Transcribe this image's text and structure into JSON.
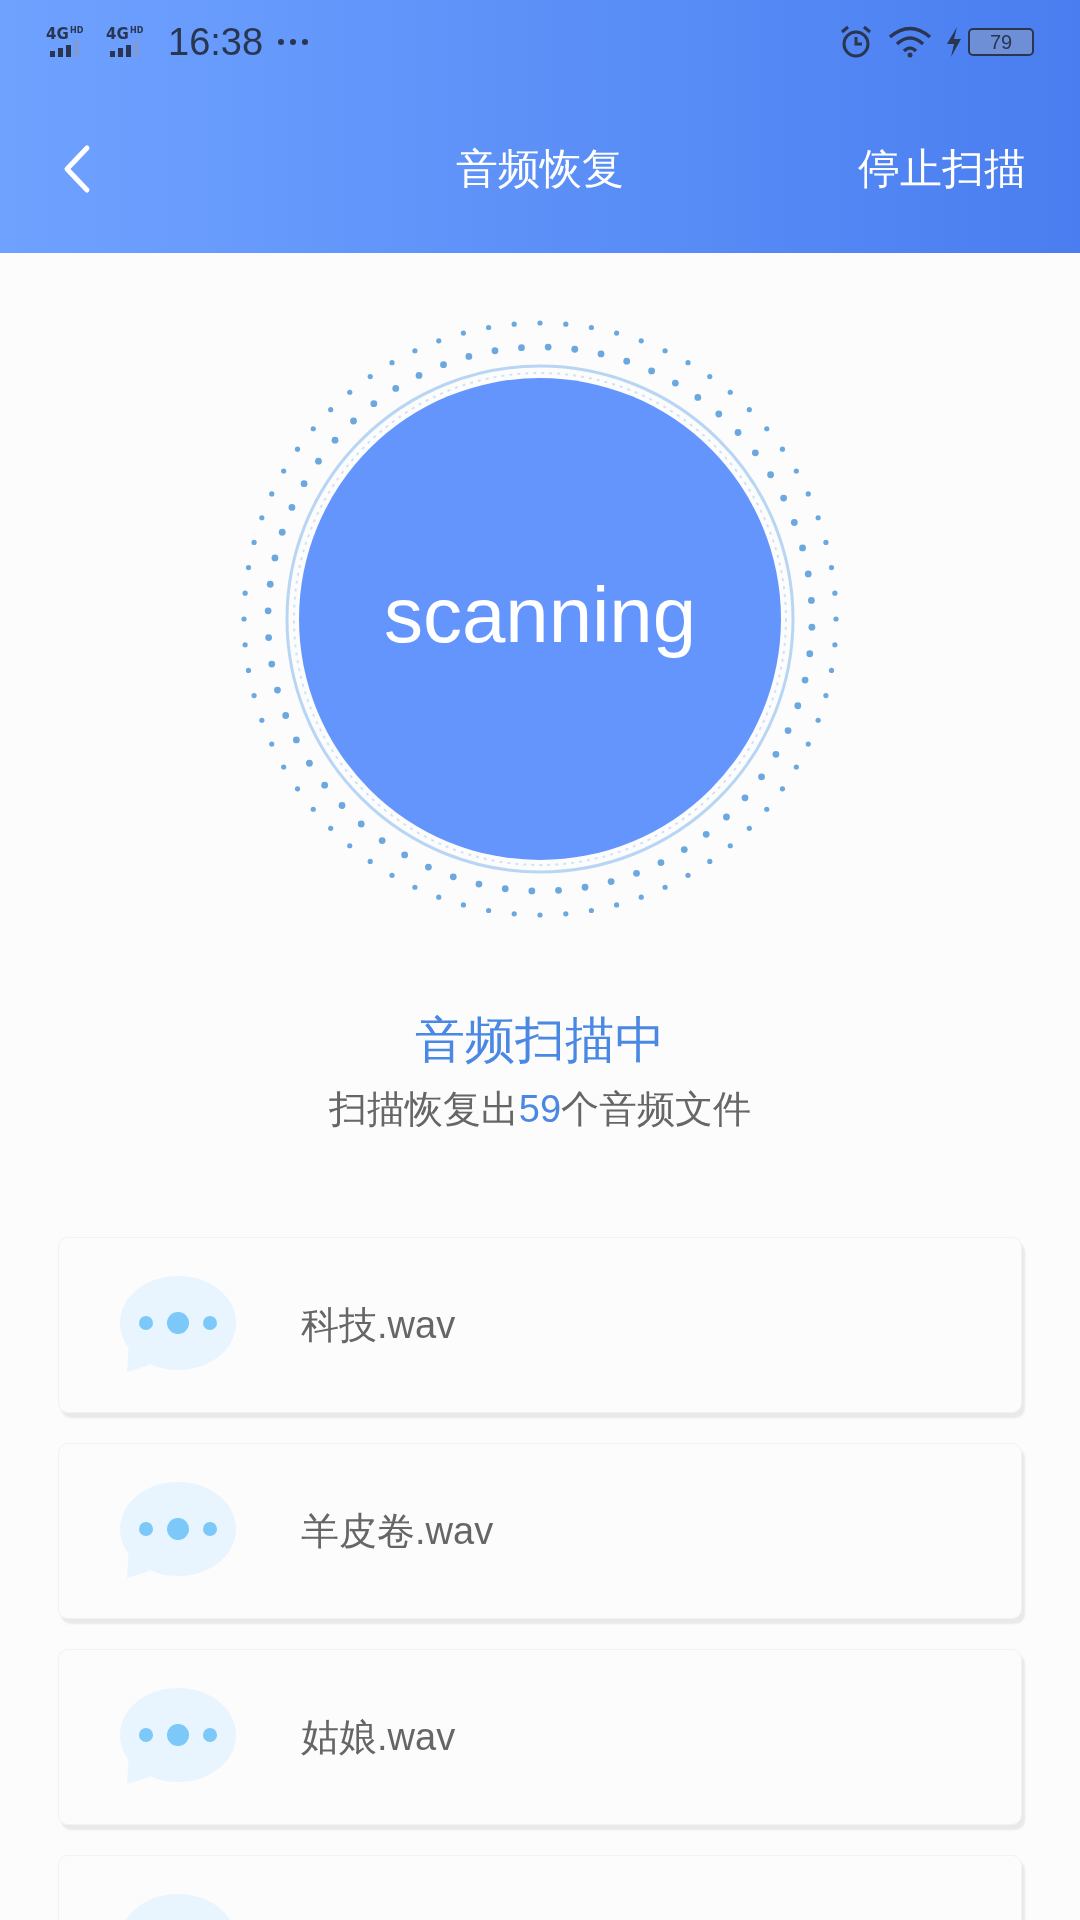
{
  "status_bar": {
    "networks": [
      {
        "type": "4G",
        "badge": "HD"
      },
      {
        "type": "4G",
        "badge": "HD"
      }
    ],
    "time": "16:38",
    "battery": "79"
  },
  "header": {
    "title": "音频恢复",
    "action": "停止扫描"
  },
  "scan": {
    "label": "scanning",
    "status": "音频扫描中",
    "summary_before": "扫描恢复出",
    "count": "59",
    "summary_after": "个音频文件"
  },
  "files": [
    {
      "kind": "file",
      "name": "科技.wav"
    },
    {
      "kind": "file",
      "name": "羊皮卷.wav"
    },
    {
      "kind": "file",
      "name": "姑娘.wav"
    },
    {
      "kind": "partial"
    }
  ]
}
